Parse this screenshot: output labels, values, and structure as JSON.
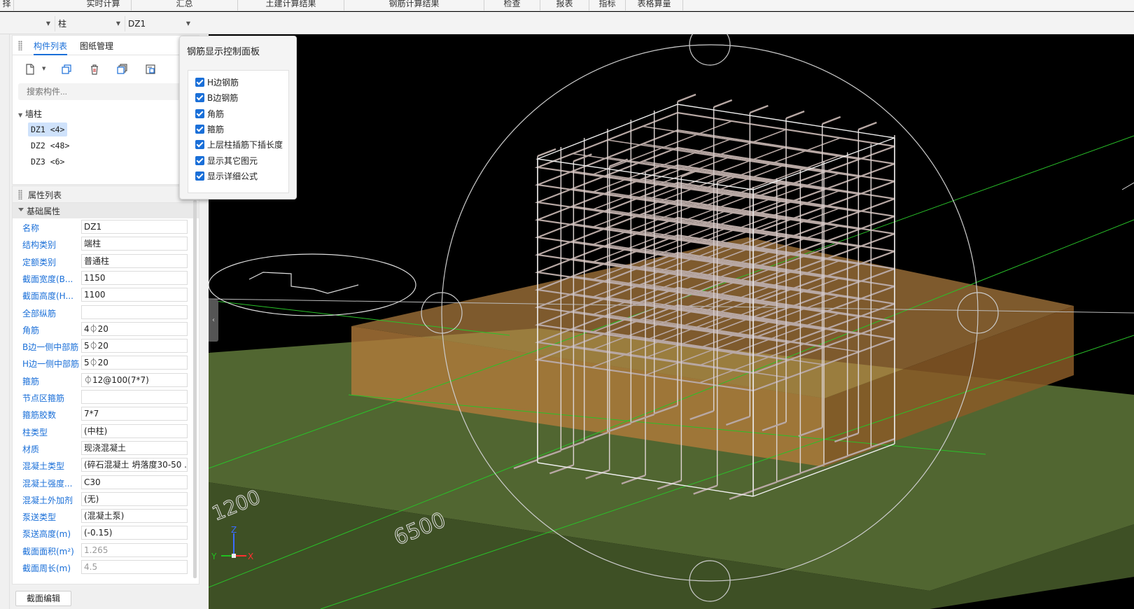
{
  "menu": {
    "items": [
      "择",
      "实时计算",
      "汇总",
      "土建计算结果",
      "钢筋计算结果",
      "检查",
      "报表",
      "指标",
      "表格算量"
    ]
  },
  "selectors": {
    "first": "",
    "category": "柱",
    "component": "DZ1"
  },
  "component_list": {
    "tabs": [
      "构件列表",
      "图纸管理"
    ],
    "active_tab": "构件列表",
    "search_placeholder": "搜索构件...",
    "group": "墙柱",
    "items": [
      "DZ1 <4>",
      "DZ2 <48>",
      "DZ3 <6>"
    ],
    "selected": "DZ1 <4>"
  },
  "properties": {
    "title": "属性列表",
    "section": "基础属性",
    "rows": [
      {
        "name": "名称",
        "value": "DZ1"
      },
      {
        "name": "结构类别",
        "value": "端柱"
      },
      {
        "name": "定额类别",
        "value": "普通柱"
      },
      {
        "name": "截面宽度(B...",
        "value": "1150"
      },
      {
        "name": "截面高度(H...",
        "value": "1100"
      },
      {
        "name": "全部纵筋",
        "value": ""
      },
      {
        "name": "角筋",
        "value": "4⏀20"
      },
      {
        "name": "B边一侧中部筋",
        "value": "5⏀20"
      },
      {
        "name": "H边一侧中部筋",
        "value": "5⏀20"
      },
      {
        "name": "箍筋",
        "value": "⏀12@100(7*7)"
      },
      {
        "name": "节点区箍筋",
        "value": ""
      },
      {
        "name": "箍筋胶数",
        "value": "7*7"
      },
      {
        "name": "柱类型",
        "value": "(中柱)"
      },
      {
        "name": "材质",
        "value": "现浇混凝土"
      },
      {
        "name": "混凝土类型",
        "value": "(碎石混凝土 坍落度30-50 ..."
      },
      {
        "name": "混凝土强度...",
        "value": "C30"
      },
      {
        "name": "混凝土外加剂",
        "value": "(无)"
      },
      {
        "name": "泵送类型",
        "value": "(混凝土泵)"
      },
      {
        "name": "泵送高度(m)",
        "value": "(-0.15)"
      },
      {
        "name": "截面面积(m²)",
        "value": "1.265"
      },
      {
        "name": "截面周长(m)",
        "value": "4.5"
      }
    ],
    "edit_button": "截面编辑"
  },
  "rebar_panel": {
    "title": "钢筋显示控制面板",
    "options": [
      {
        "label": "H边钢筋",
        "checked": true
      },
      {
        "label": "B边钢筋",
        "checked": true
      },
      {
        "label": "角筋",
        "checked": true
      },
      {
        "label": "箍筋",
        "checked": true
      },
      {
        "label": "上层柱插筋下插长度",
        "checked": true
      },
      {
        "label": "显示其它图元",
        "checked": true
      },
      {
        "label": "显示详细公式",
        "checked": true
      }
    ]
  },
  "viewport": {
    "dimension_labels": [
      "1200",
      "6500"
    ],
    "axis_labels": {
      "x": "X",
      "y": "Y",
      "z": "Z"
    }
  },
  "colors": {
    "accent": "#1a6fd8",
    "slab": "#556b34",
    "footing": "#b27a3b",
    "rebar": "#b8a8a4"
  }
}
